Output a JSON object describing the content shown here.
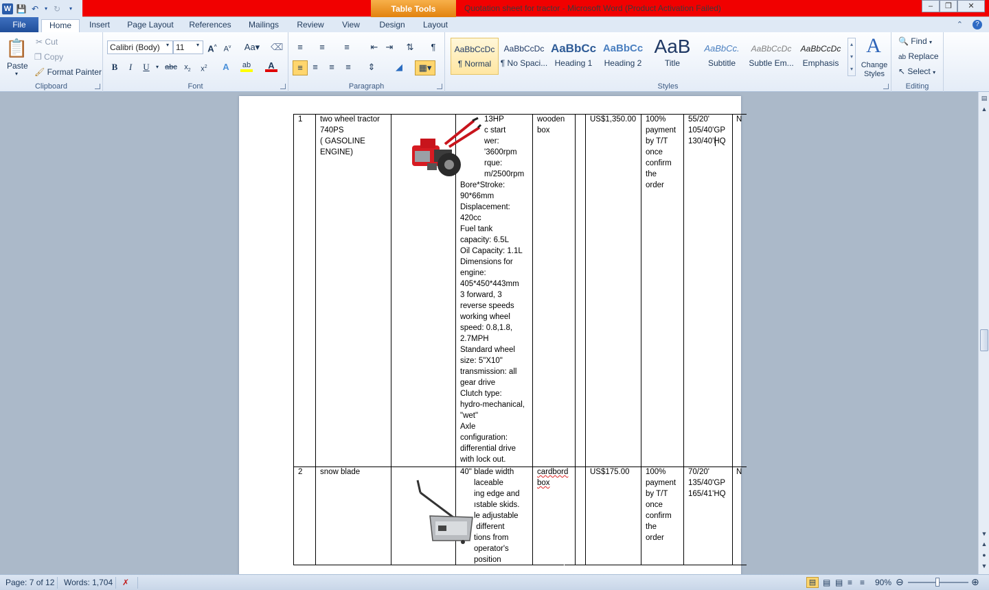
{
  "window": {
    "title": "Quotation sheet for tractor  -  Microsoft Word (Product Activation Failed)",
    "contextual_tab_group": "Table Tools",
    "buttons": [
      "minimize",
      "restore",
      "close"
    ]
  },
  "tabs": [
    "File",
    "Home",
    "Insert",
    "Page Layout",
    "References",
    "Mailings",
    "Review",
    "View",
    "Design",
    "Layout"
  ],
  "active_tab": "Home",
  "ribbon": {
    "clipboard": {
      "label": "Clipboard",
      "paste": "Paste",
      "cut": "Cut",
      "copy": "Copy",
      "format_painter": "Format Painter"
    },
    "font": {
      "label": "Font",
      "font_name": "Calibri (Body)",
      "font_size": "11"
    },
    "paragraph": {
      "label": "Paragraph"
    },
    "styles": {
      "label": "Styles",
      "items": [
        {
          "preview": "AaBbCcDc",
          "name": "¶ Normal"
        },
        {
          "preview": "AaBbCcDc",
          "name": "¶ No Spaci..."
        },
        {
          "preview": "AaBbCc",
          "name": "Heading 1"
        },
        {
          "preview": "AaBbCc",
          "name": "Heading 2"
        },
        {
          "preview": "AaB",
          "name": "Title"
        },
        {
          "preview": "AaBbCc.",
          "name": "Subtitle"
        },
        {
          "preview": "AaBbCcDc",
          "name": "Subtle Em..."
        },
        {
          "preview": "AaBbCcDc",
          "name": "Emphasis"
        }
      ],
      "change_styles": "Change Styles"
    },
    "editing": {
      "label": "Editing",
      "find": "Find",
      "replace": "Replace",
      "select": "Select"
    }
  },
  "table": {
    "rows": [
      {
        "no": "1",
        "name": "two wheel tractor\n740PS\n( GASOLINE\nENGINE)",
        "spec_top": "13HP\nc start\nwer:\n'3600rpm\nrque:\nm/2500rpm",
        "spec_bottom": "Bore*Stroke:\n90*66mm\nDisplacement:\n420cc\nFuel tank\ncapacity: 6.5L\nOil Capacity: 1.1L\nDimensions for\nengine:\n405*450*443mm\n3 forward, 3\nreverse speeds\nworking wheel\nspeed: 0.8,1.8,\n2.7MPH\nStandard wheel\nsize: 5\"X10\"\ntransmission: all\ngear drive\nClutch type:\nhydro-mechanical,\n\"wet\"\nAxle\nconfiguration:\ndifferential drive\nwith lock out.",
        "packing": "wooden\nbox",
        "price": "US$1,350.00",
        "payment": "100%\npayment\nby T/T\nonce\nconfirm\nthe\norder",
        "loading": "55/20'\n105/40'GP\n130/40'HQ",
        "extra": "N"
      },
      {
        "no": "2",
        "name": "snow blade",
        "spec_top": "40\" blade width",
        "spec_bottom": "laceable\ning edge and\nıstable skids.\nle adjustable\n different\ntions from\noperator's\nposition",
        "packing": "cardbord\nbox",
        "price": "US$175.00",
        "payment": "100%\npayment\nby T/T\nonce\nconfirm\nthe\norder",
        "loading": "70/20'\n135/40'GP\n165/41'HQ",
        "extra": "N"
      }
    ]
  },
  "status": {
    "page": "Page: 7 of 12",
    "words": "Words: 1,704",
    "zoom": "90%"
  }
}
